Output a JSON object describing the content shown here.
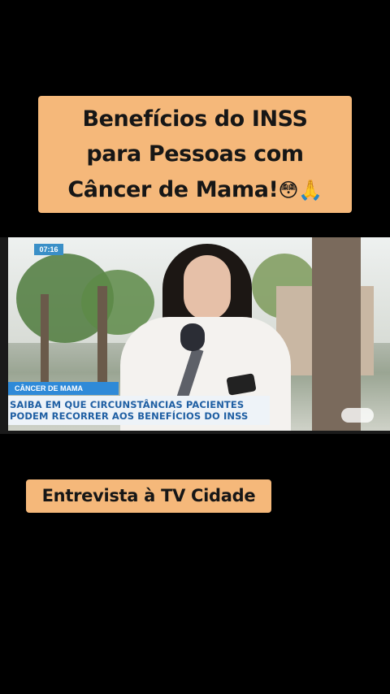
{
  "overlay_title": {
    "lines": [
      "Benefícios do INSS",
      "para Pessoas com",
      "Câncer de Mama!"
    ],
    "emojis": "😳🙏"
  },
  "tv_broadcast": {
    "clock": "07:16",
    "tag": "CÂNCER DE MAMA",
    "headline": [
      "SAIBA EM QUE CIRCUNSTÂNCIAS PACIENTES",
      "PODEM RECORRER AOS BENEFÍCIOS DO INSS"
    ]
  },
  "caption": {
    "label": "Entrevista à TV Cidade"
  },
  "colors": {
    "highlight": "#f5b87a",
    "background": "#000000",
    "tv_tag": "#2f8ad8",
    "tv_text": "#1f5fa3"
  }
}
